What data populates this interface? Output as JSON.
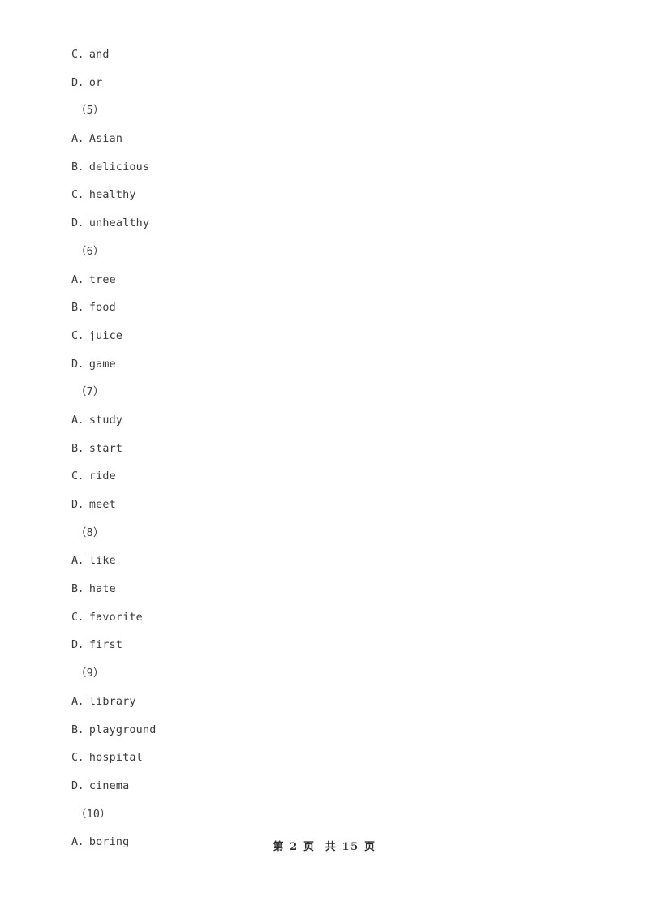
{
  "document": {
    "page_background": "#ffffff",
    "text_color": "#3a3a3a",
    "lines": [
      {
        "kind": "option",
        "letter": "C",
        "sep": "．",
        "text": "and",
        "full": "C．and"
      },
      {
        "kind": "option",
        "letter": "D",
        "sep": "．",
        "text": "or",
        "full": "D．or"
      },
      {
        "kind": "qnum",
        "full": "（5）"
      },
      {
        "kind": "option",
        "letter": "A",
        "sep": "．",
        "text": "Asian",
        "full": "A．Asian"
      },
      {
        "kind": "option",
        "letter": "B",
        "sep": "．",
        "text": "delicious",
        "full": "B．delicious"
      },
      {
        "kind": "option",
        "letter": "C",
        "sep": "．",
        "text": "healthy",
        "full": "C．healthy"
      },
      {
        "kind": "option",
        "letter": "D",
        "sep": "．",
        "text": "unhealthy",
        "full": "D．unhealthy"
      },
      {
        "kind": "qnum",
        "full": "（6）"
      },
      {
        "kind": "option",
        "letter": "A",
        "sep": "．",
        "text": "tree",
        "full": "A．tree"
      },
      {
        "kind": "option",
        "letter": "B",
        "sep": "．",
        "text": "food",
        "full": "B．food"
      },
      {
        "kind": "option",
        "letter": "C",
        "sep": "．",
        "text": "juice",
        "full": "C．juice"
      },
      {
        "kind": "option",
        "letter": "D",
        "sep": "．",
        "text": "game",
        "full": "D．game"
      },
      {
        "kind": "qnum",
        "full": "（7）"
      },
      {
        "kind": "option",
        "letter": "A",
        "sep": "．",
        "text": "study",
        "full": "A．study"
      },
      {
        "kind": "option",
        "letter": "B",
        "sep": "．",
        "text": "start",
        "full": "B．start"
      },
      {
        "kind": "option",
        "letter": "C",
        "sep": "．",
        "text": "ride",
        "full": "C．ride"
      },
      {
        "kind": "option",
        "letter": "D",
        "sep": "．",
        "text": "meet",
        "full": "D．meet"
      },
      {
        "kind": "qnum",
        "full": "（8）"
      },
      {
        "kind": "option",
        "letter": "A",
        "sep": "．",
        "text": "like",
        "full": "A．like"
      },
      {
        "kind": "option",
        "letter": "B",
        "sep": "．",
        "text": "hate",
        "full": "B．hate"
      },
      {
        "kind": "option",
        "letter": "C",
        "sep": "．",
        "text": "favorite",
        "full": "C．favorite"
      },
      {
        "kind": "option",
        "letter": "D",
        "sep": "．",
        "text": "first",
        "full": "D．first"
      },
      {
        "kind": "qnum",
        "full": "（9）"
      },
      {
        "kind": "option",
        "letter": "A",
        "sep": "．",
        "text": "library",
        "full": "A．library"
      },
      {
        "kind": "option",
        "letter": "B",
        "sep": "．",
        "text": "playground",
        "full": "B．playground"
      },
      {
        "kind": "option",
        "letter": "C",
        "sep": "．",
        "text": "hospital",
        "full": "C．hospital"
      },
      {
        "kind": "option",
        "letter": "D",
        "sep": "．",
        "text": "cinema",
        "full": "D．cinema"
      },
      {
        "kind": "qnum",
        "full": "（10）"
      },
      {
        "kind": "option",
        "letter": "A",
        "sep": "．",
        "text": "boring",
        "full": "A．boring"
      }
    ]
  },
  "footer": {
    "text": "第 2 页  共 15 页",
    "current_page": "2",
    "total_pages": "15"
  }
}
